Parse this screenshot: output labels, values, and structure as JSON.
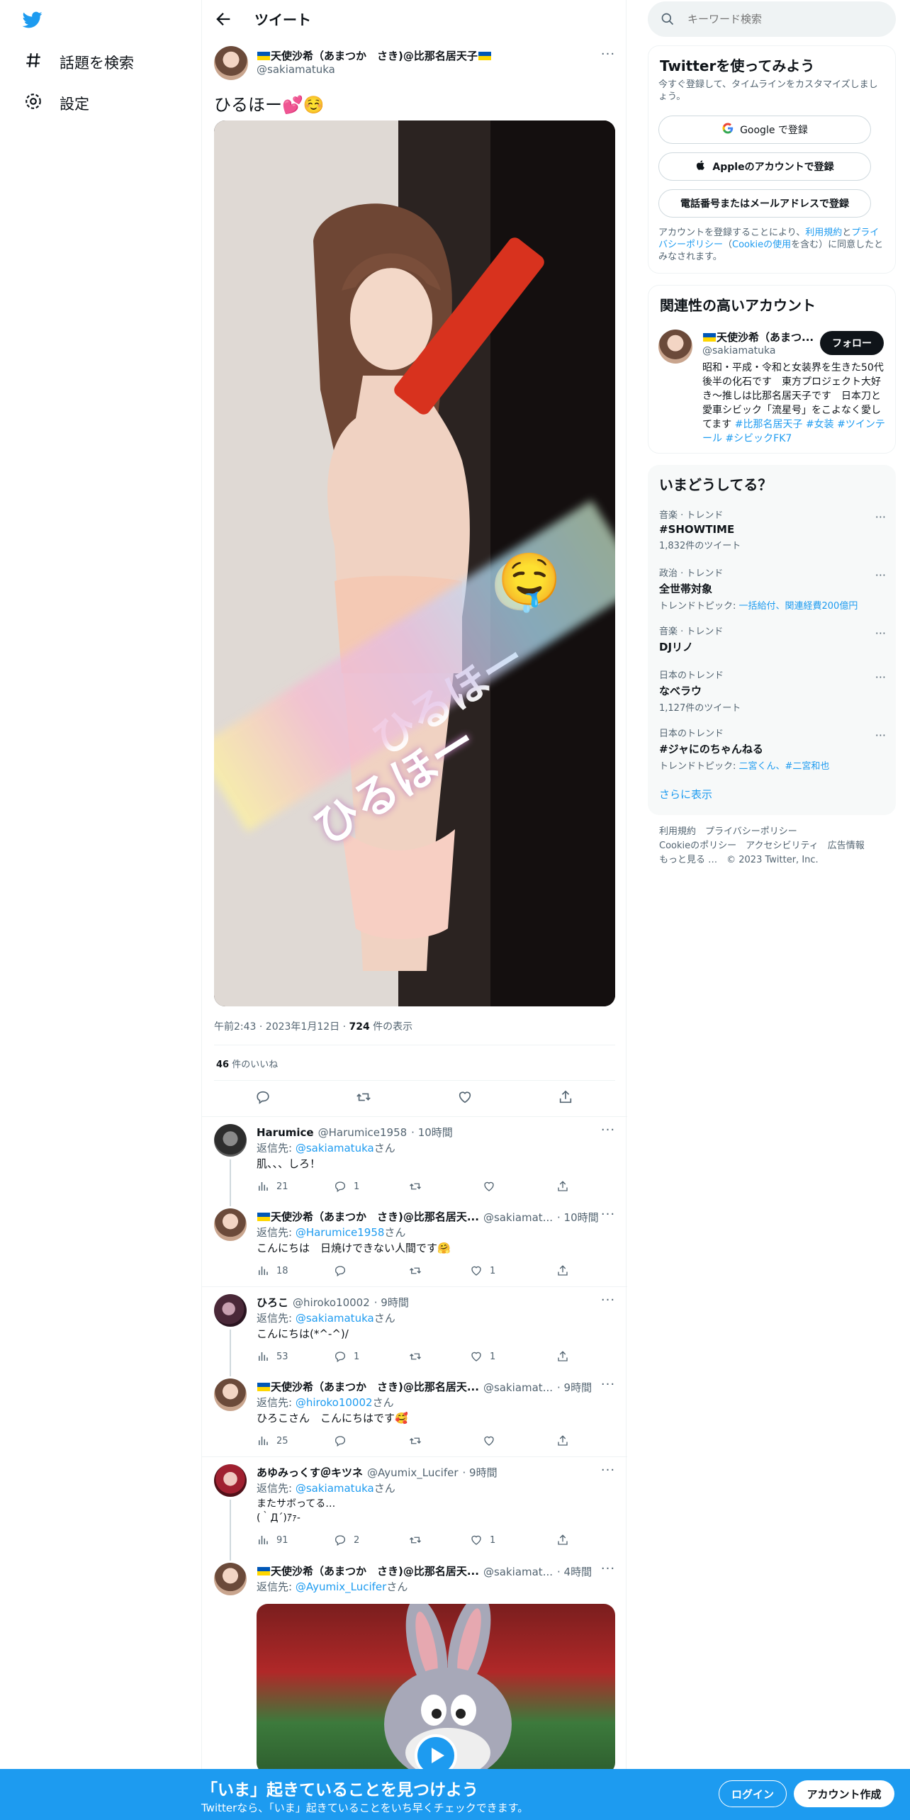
{
  "nav": {
    "explore_label": "話題を検索",
    "settings_label": "設定"
  },
  "header": {
    "title": "ツイート"
  },
  "tweet": {
    "author_name": "天使沙希（あまつか　さき)@比那名居天子",
    "author_handle": "@sakiamatuka",
    "text": "ひるほー💕☺️",
    "image_overlay_text": "ひるほー",
    "image_overlay_emoji": "🤤",
    "timestamp": "午前2:43 · 2023年1月12日 · ",
    "views_count": "724",
    "views_label": " 件の表示",
    "likes_count": "46",
    "likes_label": " 件のいいね"
  },
  "replies": [
    {
      "name": "Harumice",
      "handle": "@Harumice1958",
      "time": "· 10時間",
      "reply_to_prefix": "返信先: ",
      "reply_to": "@sakiamatuka",
      "reply_to_suffix": "さん",
      "text": "肌、、、しろ！",
      "views": "21",
      "comments": "1",
      "retweets": "",
      "likes": ""
    },
    {
      "name": "天使沙希（あまつか　さき)@比那名居天...",
      "handle": "@sakiamat...",
      "time": "· 10時間",
      "reply_to_prefix": "返信先: ",
      "reply_to": "@Harumice1958",
      "reply_to_suffix": "さん",
      "text": "こんにちは　日焼けできない人間です🤗",
      "views": "18",
      "comments": "",
      "retweets": "",
      "likes": "1"
    },
    {
      "name": "ひろこ",
      "handle": "@hiroko10002",
      "time": "· 9時間",
      "reply_to_prefix": "返信先: ",
      "reply_to": "@sakiamatuka",
      "reply_to_suffix": "さん",
      "text": "こんにちは(*^-^)/",
      "views": "53",
      "comments": "1",
      "retweets": "",
      "likes": "1"
    },
    {
      "name": "天使沙希（あまつか　さき)@比那名居天...",
      "handle": "@sakiamat...",
      "time": "· 9時間",
      "reply_to_prefix": "返信先: ",
      "reply_to": "@hiroko10002",
      "reply_to_suffix": "さん",
      "text": "ひろこさん　こんにちはです🥰",
      "views": "25",
      "comments": "",
      "retweets": "",
      "likes": ""
    },
    {
      "name": "あゆみっくす＠キツネ",
      "handle": "@Ayumix_Lucifer",
      "time": "· 9時間",
      "reply_to_prefix": "返信先: ",
      "reply_to": "@sakiamatuka",
      "reply_to_suffix": "さん",
      "text": "またサボってる…\n(｀Д´)ｱｧ-",
      "views": "91",
      "comments": "2",
      "retweets": "",
      "likes": "1"
    },
    {
      "name": "天使沙希（あまつか　さき)@比那名居天...",
      "handle": "@sakiamat...",
      "time": "· 4時間",
      "reply_to_prefix": "返信先: ",
      "reply_to": "@Ayumix_Lucifer",
      "reply_to_suffix": "さん"
    }
  ],
  "search": {
    "placeholder": "キーワード検索"
  },
  "signup_card": {
    "title": "Twitterを使ってみよう",
    "subtitle": "今すぐ登録して、タイムラインをカスタマイズしましょう。",
    "google_label": "Google で登録",
    "apple_label": "Appleのアカウントで登録",
    "phone_label": "電話番号またはメールアドレスで登録",
    "legal_prefix": "アカウントを登録することにより、",
    "legal_terms": "利用規約",
    "legal_and": "と",
    "legal_privacy": "プライバシーポリシー",
    "legal_open": "（",
    "legal_cookie": "Cookieの使用",
    "legal_suffix": "を含む）に同意したとみなされます。"
  },
  "related": {
    "title": "関連性の高いアカウント",
    "name": "天使沙希（あまつ...",
    "handle": "@sakiamatuka",
    "follow_label": "フォロー",
    "bio": "昭和・平成・令和と女装界を生きた50代後半の化石です　東方プロジェクト大好き～推しは比那名居天子です　日本刀と愛車シビック「流星号」をこよなく愛してます ",
    "bio_tags": "#比那名居天子 #女装 #ツインテール #シビックFK7"
  },
  "trends": {
    "title": "いまどうしてる？",
    "items": [
      {
        "category": "音楽 · トレンド",
        "name": "#SHOWTIME",
        "sub": "1,832件のツイート",
        "sub_link": ""
      },
      {
        "category": "政治 · トレンド",
        "name": "全世帯対象",
        "sub": "トレンドトピック: ",
        "sub_link": "一括給付、関連経費200億円"
      },
      {
        "category": "音楽 · トレンド",
        "name": "DJリノ",
        "sub": "",
        "sub_link": ""
      },
      {
        "category": "日本のトレンド",
        "name": "なべラウ",
        "sub": "1,127件のツイート",
        "sub_link": ""
      },
      {
        "category": "日本のトレンド",
        "name": "#ジャにのちゃんねる",
        "sub": "トレンドトピック: ",
        "sub_link": "二宮くん、#二宮和也"
      }
    ],
    "show_more": "さらに表示"
  },
  "footer": {
    "line1": "利用規約　プライバシーポリシー",
    "line2": "Cookieのポリシー　アクセシビリティ　広告情報",
    "line3": "もっと見る …　© 2023 Twitter, Inc."
  },
  "banner": {
    "title": "「いま」起きていることを見つけよう",
    "subtitle": "Twitterなら、「いま」起きていることをいち早くチェックできます。",
    "login_label": "ログイン",
    "signup_label": "アカウント作成"
  },
  "colors": {
    "accent": "#1d9bf0",
    "text": "#0f1419",
    "secondary": "#536471"
  }
}
